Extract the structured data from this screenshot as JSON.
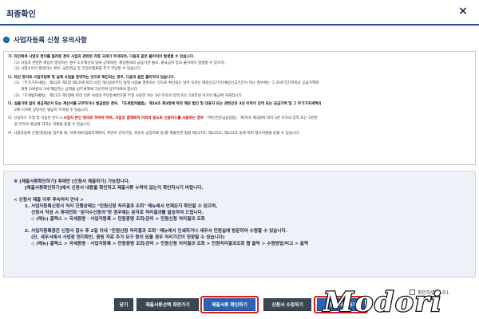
{
  "window": {
    "title": "최종확인",
    "close_glyph": "×"
  },
  "section": {
    "title": "사업자등록 신청 유의사항"
  },
  "notice": {
    "lines": [
      {
        "text": "가. 타인에게 사업자 명의를 빌려준 경우 사업과 관련된 각종 국세가 부과되며, 다음과 같은 불이익이 발생할 수 있습니다.",
        "cls": "b"
      },
      {
        "text": "(1) 사업과 관련한 체납이 발생하는 경우 소유재산의 압류·공매처분, 체납명세의 금융기관 통보, 출국금지 등의 불이익이 발생할 수 있으며,",
        "cls": "i1"
      },
      {
        "text": "(2) 사업소득이 발생하는 경우, 국민연금 및 건강보험료를 추가 부담할 수 있습니다.",
        "cls": "i1"
      },
      {
        "text": "나. 타인 명의로 사업자등록 및 실제 사업을 영위하는 것으로 확인되는 경우, 다음과 같은 불이익이 있습니다.",
        "cls": "b sp"
      },
      {
        "text": "(1) 『부가가치세법』 제22조 제1항 제2호에 따라 사업 개시일로부터 실제 사업을 영위하는 것으로 확인되는 날이 속하는 예정신고기간(예정신고기간이 지난 경우에는 그 과세기간)까지의 공급가액에",
        "cls": "i1"
      },
      {
        "text": "대해 100분의 1에 해당하는 금액을 납부세액에 가산하여 납부하여야 합니다.",
        "cls": "i2"
      },
      {
        "text": "(2) 『조세범처벌법』 제11조 제1항에 따라 다른 사람의 주민등록번호를 부정 사용한 자는 3년 이하의 징역 또는 1천만원 이하의 벌금에 처해집니다.",
        "cls": "i1"
      },
      {
        "text": "다. 실물거래 없이 세금계산서 또는 계산서를 교부하거나 발급받은 경우, 『조세범처벌법』 제10조 제3항에 따라 해당 법인 및 대표자 또는 관련인은 3년 이하의 징역 또는 공급가액 및 그 부가가치세액의",
        "cls": "b sp"
      },
      {
        "text": "2배 이하에 상당하는 벌금이 부과될 수 있습니다.",
        "cls": "i1"
      },
      {
        "pre": "라. 신용카드 가맹 및 이용은 반드시 ",
        "hl": "사업자 본인 명의로 하여야 하며, 사업상 결제목적 이외의 용도로 신용카드를 사용하는 경우",
        "post": " 『여신전문금융업법』 제70조 제3항에 따라 3년 이하의 징역 또는 2천만",
        "cls": "sp"
      },
      {
        "text": "원 이하의 벌금에 처하는 처벌을 받을 수 있습니다.",
        "cls": "i1"
      },
      {
        "text": "마. 사업자등록 신청(정정)을 접수할 때, 허위서류(임대차계약서, 위변조 인허가증, 위변조 공증자료 등)를 제출하면 형법 제137조, 제225조, 제231조 등에 따라 형사처벌을 받을 수 있습니다.",
        "cls": "sp"
      }
    ]
  },
  "guide": {
    "lines": [
      {
        "text": "※   [제출서류확인하기] 후에만 [신청서 제출하기] 가능합니다.",
        "cls": ""
      },
      {
        "text": "[제출서류확인하기]에서 신청서 내용을 확인하고 제출서류 누락이 없는지 확인하시기 바랍니다.",
        "cls": "i1"
      },
      {
        "text": "< 신청서 제출 이후 후속처리 안내 >",
        "cls": "gap"
      },
      {
        "text": "1.  사업자등록신청서 처리 진행상태는 \"민원신청 처리결과 조회\" 메뉴에서 언제든지 확인할 수 있으며,",
        "cls": "i1"
      },
      {
        "text": "신청서 작성 시 휴대전화 \"문자수신동의\"한 경우에는 문자로 처리결과를 발송하여 드립니다.",
        "cls": "i2"
      },
      {
        "text": "◇ (메뉴) 홈택스 > 국세증명 · 사업자등록 > 민원증명 조회/관리 > 민원신청 처리결과 조회",
        "cls": "i2"
      },
      {
        "text": "2.  사업자등록증은 신청서 접수 후 2일 이내 \"민원신청 처리결과 조회\" 메뉴에서 인쇄하거나 세무서 민원실에 방문하여 수령할 수 있습니다.",
        "cls": "i1 gap"
      },
      {
        "text": "(단, 세무서에서 사업장 현지확인, 증빙 자료 추가 요구 등이 있을 경우 처리기간이 연장될 수 있습니다)",
        "cls": "i2"
      },
      {
        "text": "◇ (메뉴) 홈택스 > 국세증명 · 사업자등록 > 민원증명 조회/관리 > 민원신청 처리결과 조회 > 민원처리결과조회 탭 클릭 > 수령방법/비고 > 출력",
        "cls": "i2"
      }
    ]
  },
  "confirm": {
    "label": "확인하였습니다."
  },
  "buttons": {
    "close": "닫기",
    "back": "제출서류선택 화면가기",
    "check_docs": "제출서류 확인하기",
    "edit": "신청서 수정하기",
    "submit": "신청서 제출하기"
  },
  "watermark": {
    "text": "Modori"
  },
  "colors": {
    "header_navy": "#1a2d57",
    "highlight_red": "#cc0000",
    "annotation_red": "#e01a1a",
    "button_dark": "#3c4654",
    "button_blue": "#2b63b5",
    "guide_bg": "#eef2f8"
  }
}
